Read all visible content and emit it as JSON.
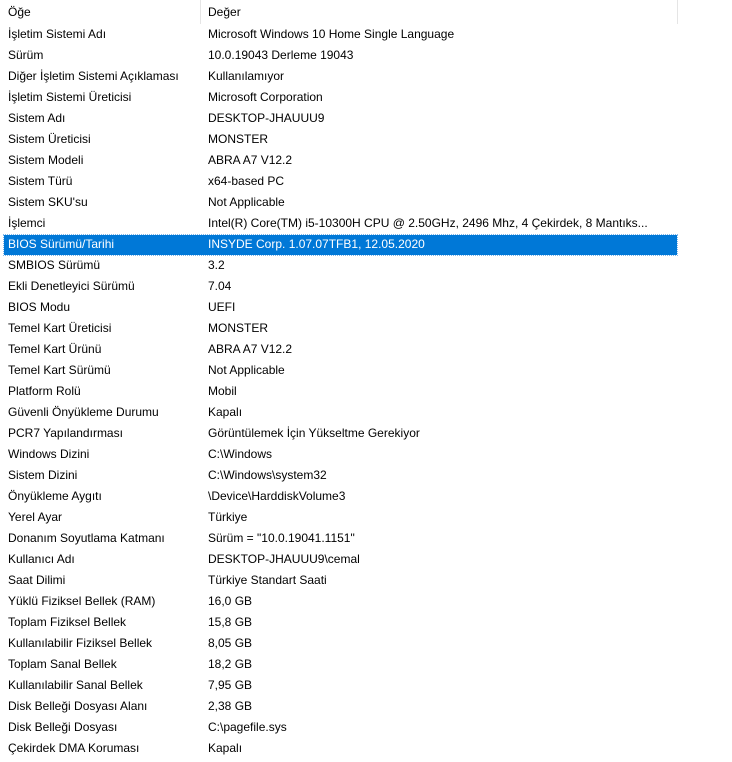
{
  "columns": {
    "item": "Öğe",
    "value": "Değer"
  },
  "selected_color": "#0078d7",
  "rows": [
    {
      "item": "İşletim Sistemi Adı",
      "value": "Microsoft Windows 10 Home Single Language"
    },
    {
      "item": "Sürüm",
      "value": "10.0.19043 Derleme 19043"
    },
    {
      "item": "Diğer İşletim Sistemi Açıklaması",
      "value": "Kullanılamıyor"
    },
    {
      "item": "İşletim Sistemi Üreticisi",
      "value": "Microsoft Corporation"
    },
    {
      "item": "Sistem Adı",
      "value": "DESKTOP-JHAUUU9"
    },
    {
      "item": "Sistem Üreticisi",
      "value": "MONSTER"
    },
    {
      "item": "Sistem Modeli",
      "value": "ABRA A7 V12.2"
    },
    {
      "item": "Sistem Türü",
      "value": "x64-based PC"
    },
    {
      "item": "Sistem SKU'su",
      "value": "Not Applicable"
    },
    {
      "item": "İşlemci",
      "value": "Intel(R) Core(TM) i5-10300H CPU @ 2.50GHz, 2496 Mhz, 4 Çekirdek, 8 Mantıks..."
    },
    {
      "item": "BIOS Sürümü/Tarihi",
      "value": "INSYDE Corp. 1.07.07TFB1, 12.05.2020",
      "selected": true
    },
    {
      "item": "SMBIOS Sürümü",
      "value": "3.2"
    },
    {
      "item": "Ekli Denetleyici Sürümü",
      "value": "7.04"
    },
    {
      "item": "BIOS Modu",
      "value": "UEFI"
    },
    {
      "item": "Temel Kart Üreticisi",
      "value": "MONSTER"
    },
    {
      "item": "Temel Kart Ürünü",
      "value": "ABRA A7 V12.2"
    },
    {
      "item": "Temel Kart Sürümü",
      "value": "Not Applicable"
    },
    {
      "item": "Platform Rolü",
      "value": "Mobil"
    },
    {
      "item": "Güvenli Önyükleme Durumu",
      "value": "Kapalı"
    },
    {
      "item": "PCR7 Yapılandırması",
      "value": "Görüntülemek İçin Yükseltme Gerekiyor"
    },
    {
      "item": "Windows Dizini",
      "value": "C:\\Windows"
    },
    {
      "item": "Sistem Dizini",
      "value": "C:\\Windows\\system32"
    },
    {
      "item": "Önyükleme Aygıtı",
      "value": "\\Device\\HarddiskVolume3"
    },
    {
      "item": "Yerel Ayar",
      "value": "Türkiye"
    },
    {
      "item": "Donanım Soyutlama Katmanı",
      "value": "Sürüm = \"10.0.19041.1151\""
    },
    {
      "item": "Kullanıcı Adı",
      "value": "DESKTOP-JHAUUU9\\cemal"
    },
    {
      "item": "Saat Dilimi",
      "value": "Türkiye Standart Saati"
    },
    {
      "item": "Yüklü Fiziksel Bellek (RAM)",
      "value": "16,0 GB"
    },
    {
      "item": "Toplam Fiziksel Bellek",
      "value": "15,8 GB"
    },
    {
      "item": "Kullanılabilir Fiziksel Bellek",
      "value": "8,05 GB"
    },
    {
      "item": "Toplam Sanal Bellek",
      "value": "18,2 GB"
    },
    {
      "item": "Kullanılabilir Sanal Bellek",
      "value": "7,95 GB"
    },
    {
      "item": "Disk Belleği Dosyası Alanı",
      "value": "2,38 GB"
    },
    {
      "item": "Disk Belleği Dosyası",
      "value": "C:\\pagefile.sys"
    },
    {
      "item": "Çekirdek DMA Koruması",
      "value": "Kapalı"
    }
  ]
}
